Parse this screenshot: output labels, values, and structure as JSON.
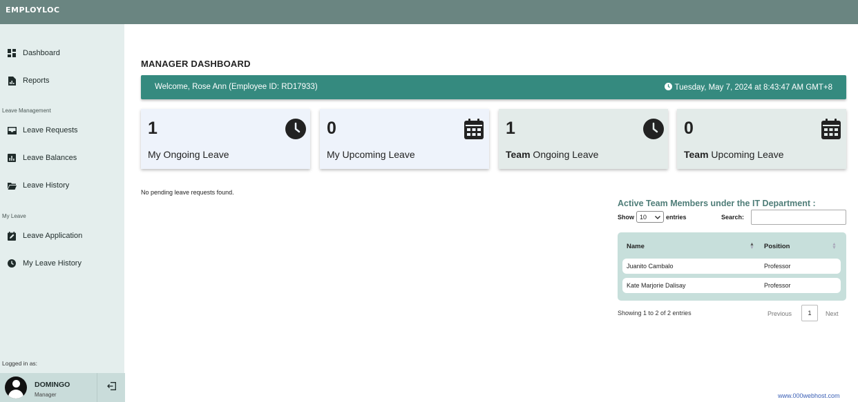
{
  "app": {
    "brand": "EMPLOYLOC"
  },
  "sidebar": {
    "items_top": [
      {
        "label": "Dashboard",
        "icon": "dashboard-icon"
      },
      {
        "label": "Reports",
        "icon": "report-file-icon"
      }
    ],
    "section_leave_management": "Leave Management",
    "items_leave_management": [
      {
        "label": "Leave Requests",
        "icon": "inbox-icon"
      },
      {
        "label": "Leave Balances",
        "icon": "bar-chart-icon"
      },
      {
        "label": "Leave History",
        "icon": "folder-open-icon"
      }
    ],
    "section_my_leave": "My Leave",
    "items_my_leave": [
      {
        "label": "Leave Application",
        "icon": "edit-calendar-icon"
      },
      {
        "label": "My Leave History",
        "icon": "clock-icon"
      }
    ],
    "logged_in_label": "Logged in as:",
    "user": {
      "name": "DOMINGO",
      "role": "Manager"
    }
  },
  "main": {
    "title": "MANAGER DASHBOARD",
    "welcome": "Welcome, Rose Ann (Employee ID: RD17933)",
    "datetime": "Tuesday, May 7, 2024 at 8:43:47 AM GMT+8",
    "cards": [
      {
        "value": "1",
        "label_bold": "",
        "label": "My Ongoing Leave",
        "icon": "clock-icon"
      },
      {
        "value": "0",
        "label_bold": "",
        "label": "My Upcoming Leave",
        "icon": "calendar-icon"
      },
      {
        "value": "1",
        "label_bold": "Team",
        "label": " Ongoing Leave",
        "icon": "clock-icon"
      },
      {
        "value": "0",
        "label_bold": "Team",
        "label": " Upcoming Leave",
        "icon": "calendar-icon"
      }
    ],
    "no_pending": "No pending leave requests found.",
    "team": {
      "title": "Active Team Members under the IT Department :",
      "show_label": "Show",
      "entries_value": "10",
      "entries_label": "entries",
      "search_label": "Search:",
      "search_value": "",
      "columns": [
        "Name",
        "Position"
      ],
      "rows": [
        [
          "Juanito Cambalo",
          "Professor"
        ],
        [
          "Kate Marjorie Dalisay",
          "Professor"
        ]
      ],
      "showing": "Showing 1 to 2 of 2 entries",
      "pagination": {
        "previous": "Previous",
        "current": "1",
        "next": "Next"
      }
    },
    "footer_link": "www.000webhost.com"
  },
  "colors": {
    "topbar": "#6a8581",
    "sidebar": "#e4eeed",
    "accent": "#358a7f",
    "team_title": "#4f7d78",
    "table_bg": "#c7dfdb"
  }
}
